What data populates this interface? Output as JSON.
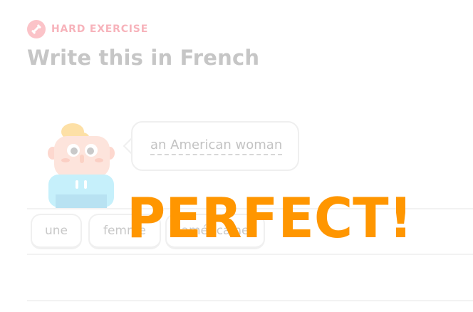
{
  "header": {
    "exercise_label": "HARD EXERCISE",
    "icon": "dumbbell-icon",
    "accent_color": "#f7b3bb"
  },
  "title": "Write this in French",
  "prompt": {
    "text": "an American woman"
  },
  "word_bank": [
    {
      "label": "une"
    },
    {
      "label": "femme"
    },
    {
      "label": "américaine"
    }
  ],
  "feedback": {
    "text": "PERFECT!",
    "color": "#ff9600"
  }
}
